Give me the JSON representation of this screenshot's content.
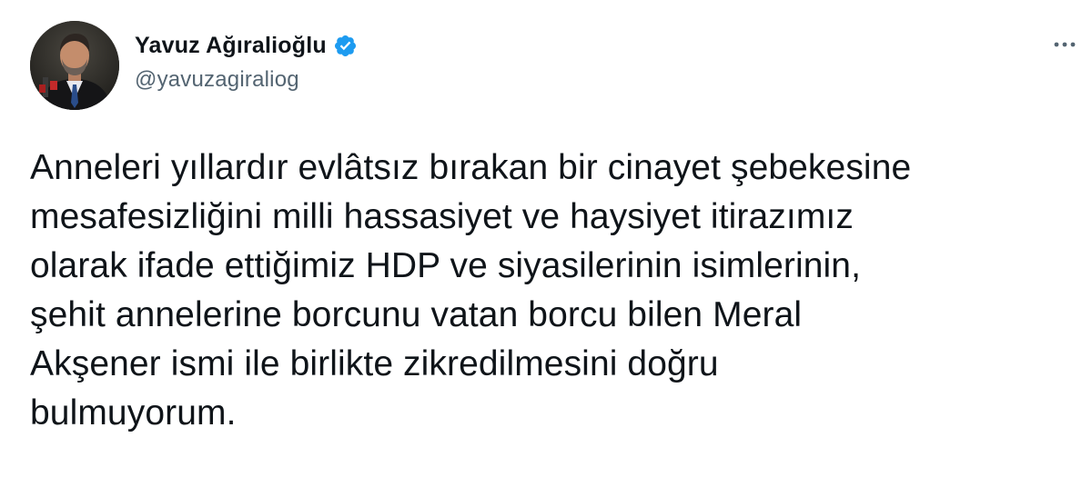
{
  "tweet": {
    "author": {
      "display_name": "Yavuz Ağıralioğlu",
      "handle": "@yavuzagiraliog",
      "verified_badge_icon": "verified-badge-icon",
      "avatar_description_icon": "profile-photo"
    },
    "more_icon": "more-options-icon",
    "text_lines": [
      "Anneleri yıllardır evlâtsız bırakan bir cinayet şebekesine",
      "mesafesizliğini milli hassasiyet ve haysiyet itirazımız",
      "olarak ifade ettiğimiz HDP ve siyasilerinin isimlerinin,",
      "şehit annelerine borcunu vatan borcu bilen Meral",
      "Akşener ismi ile birlikte zikredilmesini doğru",
      "bulmuyorum."
    ],
    "colors": {
      "text": "#0f1419",
      "handle": "#536471",
      "verified": "#1d9bf0",
      "background": "#ffffff"
    }
  }
}
